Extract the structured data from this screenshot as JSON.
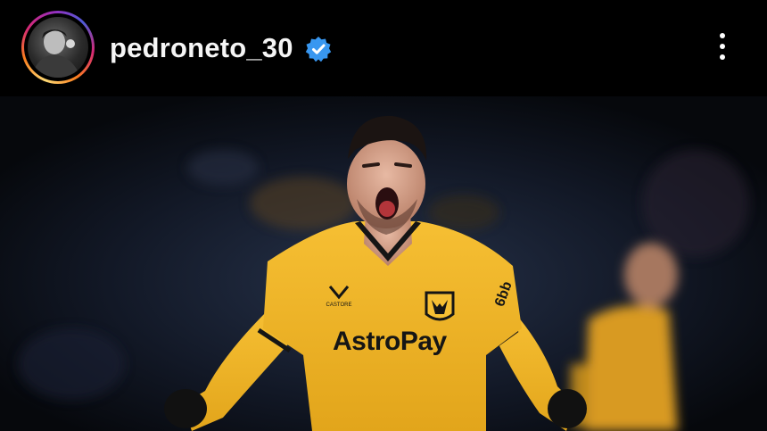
{
  "header": {
    "username": "pedroneto_30",
    "verified": true,
    "avatar_icon": "profile-photo",
    "more_icon": "more-vertical-icon"
  },
  "photo": {
    "jersey_sponsor": "AstroPay",
    "sleeve_sponsor": "6bb",
    "kit_brand": "CASTORE"
  },
  "colors": {
    "background": "#000000",
    "verified_badge": "#3897f0",
    "jersey_gold": "#f2b325",
    "jersey_trim": "#151515"
  }
}
